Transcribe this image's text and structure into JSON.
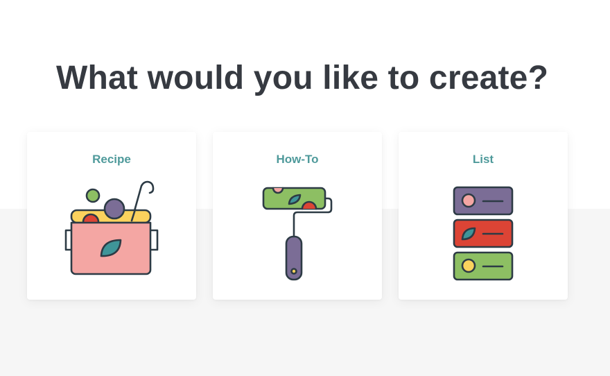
{
  "page": {
    "title": "What would you like to create?"
  },
  "cards": [
    {
      "label": "Recipe",
      "icon": "recipe-pot-icon"
    },
    {
      "label": "How-To",
      "icon": "paint-roller-icon"
    },
    {
      "label": "List",
      "icon": "list-stack-icon"
    }
  ],
  "colors": {
    "heading": "#363a41",
    "card_label": "#4f9a9b",
    "outline": "#2d3b45",
    "pink": "#f4a6a3",
    "yellow": "#fbd25d",
    "purple": "#7b6d96",
    "green": "#8dbf63",
    "red": "#dc4435",
    "teal": "#3f9599"
  }
}
